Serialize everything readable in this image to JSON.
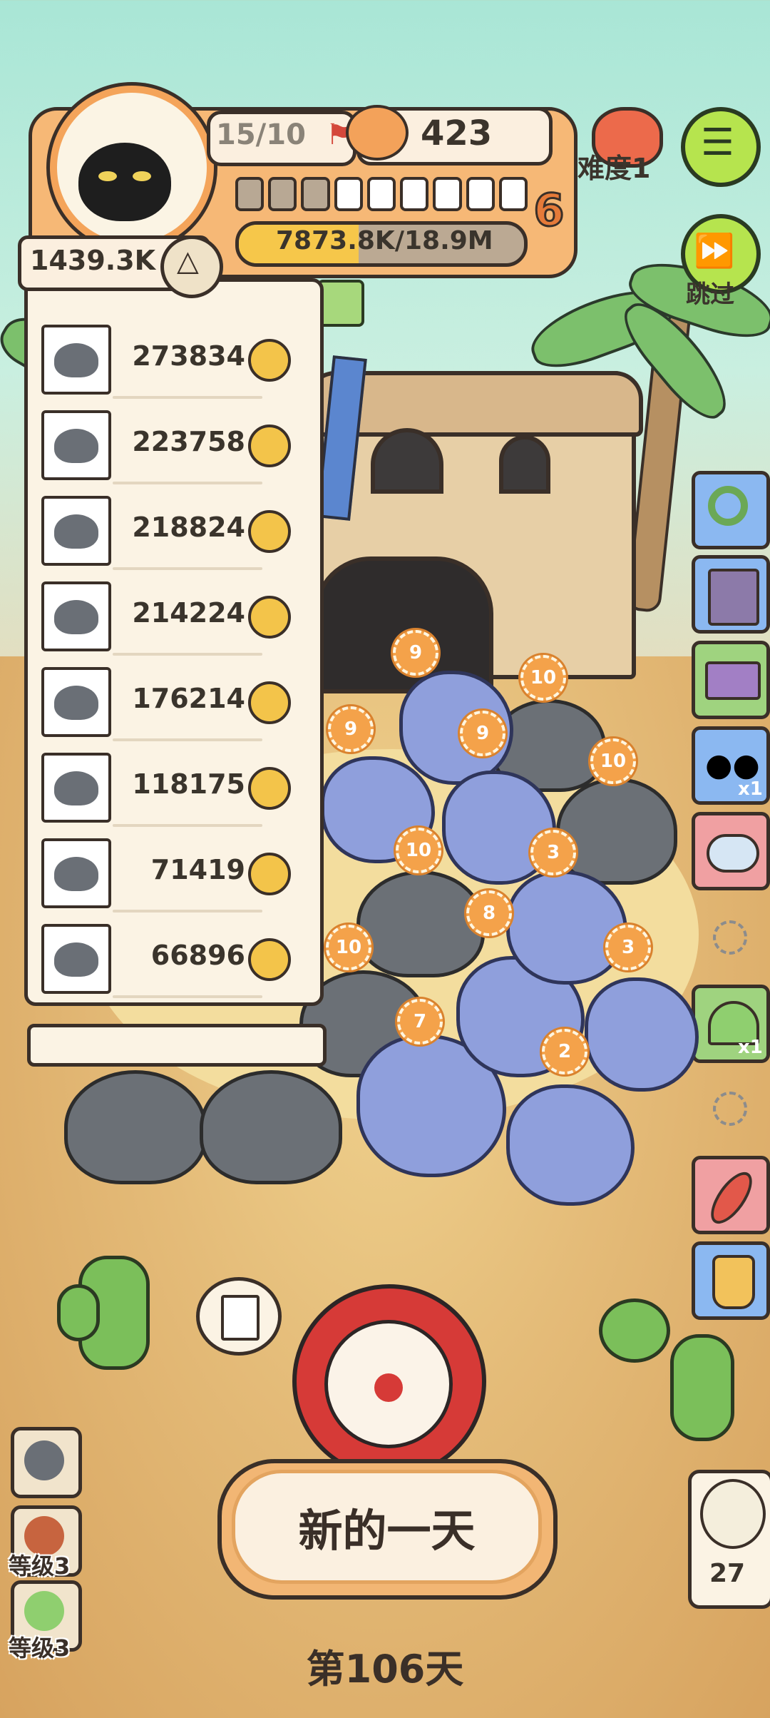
{
  "header": {
    "flag_count": "15/10",
    "coins": "423",
    "difficulty": "难度1",
    "level": "6",
    "exp": "7873.8K/18.9M",
    "exp_fraction": 0.42,
    "stars_filled": 3,
    "stars_total": 9
  },
  "skip_label": "跳过",
  "total": "1439.3K",
  "list": [
    {
      "value": "273834"
    },
    {
      "value": "223758"
    },
    {
      "value": "218824"
    },
    {
      "value": "214224"
    },
    {
      "value": "176214"
    },
    {
      "value": "118175"
    },
    {
      "value": "71419"
    },
    {
      "value": "66896"
    }
  ],
  "side_items": {
    "binoculars_count": "x1",
    "tent_count": "x1"
  },
  "badges": [
    "9",
    "10",
    "9",
    "9",
    "10",
    "10",
    "3",
    "8",
    "10",
    "3",
    "7",
    "2"
  ],
  "bottom": {
    "new_day": "新的一天",
    "day": "第106天",
    "level_a": "等级3",
    "level_b": "等级3",
    "owl_count": "27"
  },
  "colors": {
    "accent": "#f2b674",
    "menu_green": "#b6e44e",
    "bar_fill": "#f6c74a"
  }
}
